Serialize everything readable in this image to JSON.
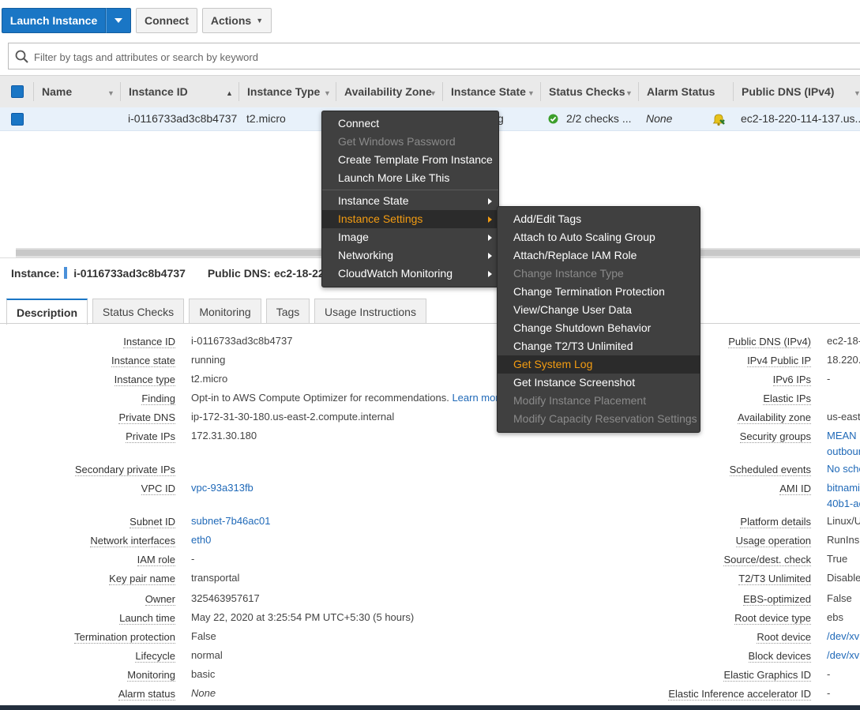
{
  "toolbar": {
    "launch_label": "Launch Instance",
    "connect_label": "Connect",
    "actions_label": "Actions"
  },
  "search": {
    "placeholder": "Filter by tags and attributes or search by keyword"
  },
  "grid": {
    "columns": [
      "Name",
      "Instance ID",
      "Instance Type",
      "Availability Zone",
      "Instance State",
      "Status Checks",
      "Alarm Status",
      "Public DNS (IPv4)"
    ],
    "row": {
      "name": "",
      "instance_id": "i-0116733ad3c8b4737",
      "instance_type": "t2.micro",
      "state_tail": "g",
      "status_checks": "2/2 checks ...",
      "alarm_status": "None",
      "public_dns": "ec2-18-220-114-137.us..."
    }
  },
  "selection": {
    "instance_label": "Instance:",
    "instance_id": "i-0116733ad3c8b4737",
    "dns_label": "Public DNS: ec2-18-22"
  },
  "tabs": [
    "Description",
    "Status Checks",
    "Monitoring",
    "Tags",
    "Usage Instructions"
  ],
  "details_left": [
    {
      "label": "Instance ID",
      "value": "i-0116733ad3c8b4737"
    },
    {
      "label": "Instance state",
      "value": "running"
    },
    {
      "label": "Instance type",
      "value": "t2.micro"
    },
    {
      "label": "Finding",
      "value": "Opt-in to AWS Compute Optimizer for recommendations.",
      "link": "Learn mor"
    },
    {
      "label": "Private DNS",
      "value": "ip-172-31-30-180.us-east-2.compute.internal"
    },
    {
      "label": "Private IPs",
      "value": "172.31.30.180"
    },
    {
      "label": "Secondary private IPs",
      "value": ""
    },
    {
      "label": "VPC ID",
      "value": "vpc-93a313fb"
    },
    {
      "label": "Subnet ID",
      "value": "subnet-7b46ac01"
    },
    {
      "label": "Network interfaces",
      "value": "eth0"
    },
    {
      "label": "IAM role",
      "value": "-"
    },
    {
      "label": "Key pair name",
      "value": "transportal"
    },
    {
      "label": "Owner",
      "value": "325463957617"
    },
    {
      "label": "Launch time",
      "value": "May 22, 2020 at 3:25:54 PM UTC+5:30 (5 hours)"
    },
    {
      "label": "Termination protection",
      "value": "False"
    },
    {
      "label": "Lifecycle",
      "value": "normal"
    },
    {
      "label": "Monitoring",
      "value": "basic"
    },
    {
      "label": "Alarm status",
      "value": "None"
    }
  ],
  "details_right": [
    {
      "label": "Public DNS (IPv4)",
      "value": "ec2-18-"
    },
    {
      "label": "IPv4 Public IP",
      "value": "18.220."
    },
    {
      "label": "IPv6 IPs",
      "value": "-"
    },
    {
      "label": "Elastic IPs",
      "value": ""
    },
    {
      "label": "Availability zone",
      "value": "us-east"
    },
    {
      "label": "Security groups",
      "value": "MEAN",
      "value2": "outbour"
    },
    {
      "label": "Scheduled events",
      "value": "No sche"
    },
    {
      "label": "AMI ID",
      "value": "bitnami",
      "value2": "40b1-ac"
    },
    {
      "label": "Platform details",
      "value": "Linux/U"
    },
    {
      "label": "Usage operation",
      "value": "RunIns"
    },
    {
      "label": "Source/dest. check",
      "value": "True"
    },
    {
      "label": "T2/T3 Unlimited",
      "value": "Disable"
    },
    {
      "label": "EBS-optimized",
      "value": "False"
    },
    {
      "label": "Root device type",
      "value": "ebs"
    },
    {
      "label": "Root device",
      "value": "/dev/xv"
    },
    {
      "label": "Block devices",
      "value": "/dev/xv"
    },
    {
      "label": "Elastic Graphics ID",
      "value": "-"
    },
    {
      "label": "Elastic Inference accelerator ID",
      "value": "-"
    }
  ],
  "menu1": {
    "items": [
      "Connect",
      "Get Windows Password",
      "Create Template From Instance",
      "Launch More Like This"
    ],
    "submenus": [
      "Instance State",
      "Instance Settings",
      "Image",
      "Networking",
      "CloudWatch Monitoring"
    ]
  },
  "menu2": {
    "items": [
      "Add/Edit Tags",
      "Attach to Auto Scaling Group",
      "Attach/Replace IAM Role",
      "Change Instance Type",
      "Change Termination Protection",
      "View/Change User Data",
      "Change Shutdown Behavior",
      "Change T2/T3 Unlimited",
      "Get System Log",
      "Get Instance Screenshot",
      "Modify Instance Placement",
      "Modify Capacity Reservation Settings"
    ]
  },
  "colors": {
    "accent": "#1a76c5",
    "menu_highlight": "#f39c12",
    "menu_bg": "#404040",
    "link": "#1f69b8"
  }
}
